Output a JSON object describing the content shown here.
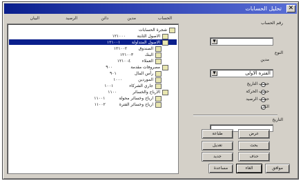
{
  "window": {
    "title": "تحليل الحسابات"
  },
  "columns": [
    "الحساب",
    "مدين",
    "دائن",
    "الرصيد",
    "البيان"
  ],
  "tree": [
    {
      "text": "شجرة الحسابات",
      "num": ""
    },
    {
      "text": "الاصول الثابتة",
      "num": "١٢١٠٠٠"
    },
    {
      "text": "الاصول المتداولة",
      "num": "١٢١٠٠١"
    },
    {
      "text": "الصندوق",
      "num": "١٢١٠٠٢",
      "selected": true
    },
    {
      "text": "البنك",
      "num": "١٢١٠٠٣"
    },
    {
      "text": "العملاء",
      "num": "١٢١٠٠٤"
    },
    {
      "text": "مصروفات مقدمة",
      "num": "٩٠٠"
    },
    {
      "text": "رأس المال",
      "num": "٩٠١"
    },
    {
      "text": "الموردين",
      "num": "١٠٠٠"
    },
    {
      "text": "جاري الشركاء",
      "num": "١٠٠١"
    },
    {
      "text": "الارباح والخسائر",
      "num": "١١٠٠"
    },
    {
      "text": "ارباح وخسائر محولة",
      "num": "١١٠٠١"
    },
    {
      "text": "ارباح وخسائر الفترة",
      "num": "١١٠٠٢"
    }
  ],
  "right": {
    "label_account": "رقم الحساب",
    "account_value": "",
    "label_type": "النوع",
    "type_value": "مدين",
    "label_period": "الفترة",
    "period_value": "الفترة الاولى",
    "radio_options": [
      "حسب التاريخ",
      "حسب الحركة",
      "حسب الرصيد",
      "الكل"
    ],
    "label_date": "التاريخ"
  },
  "buttons": {
    "b1": "عرض",
    "b2": "طباعة",
    "b3": "بحث",
    "b4": "تعديل",
    "b5": "حذف",
    "b6": "جديد",
    "ok": "موافق",
    "cancel": "الغاء",
    "help": "مساعدة"
  }
}
